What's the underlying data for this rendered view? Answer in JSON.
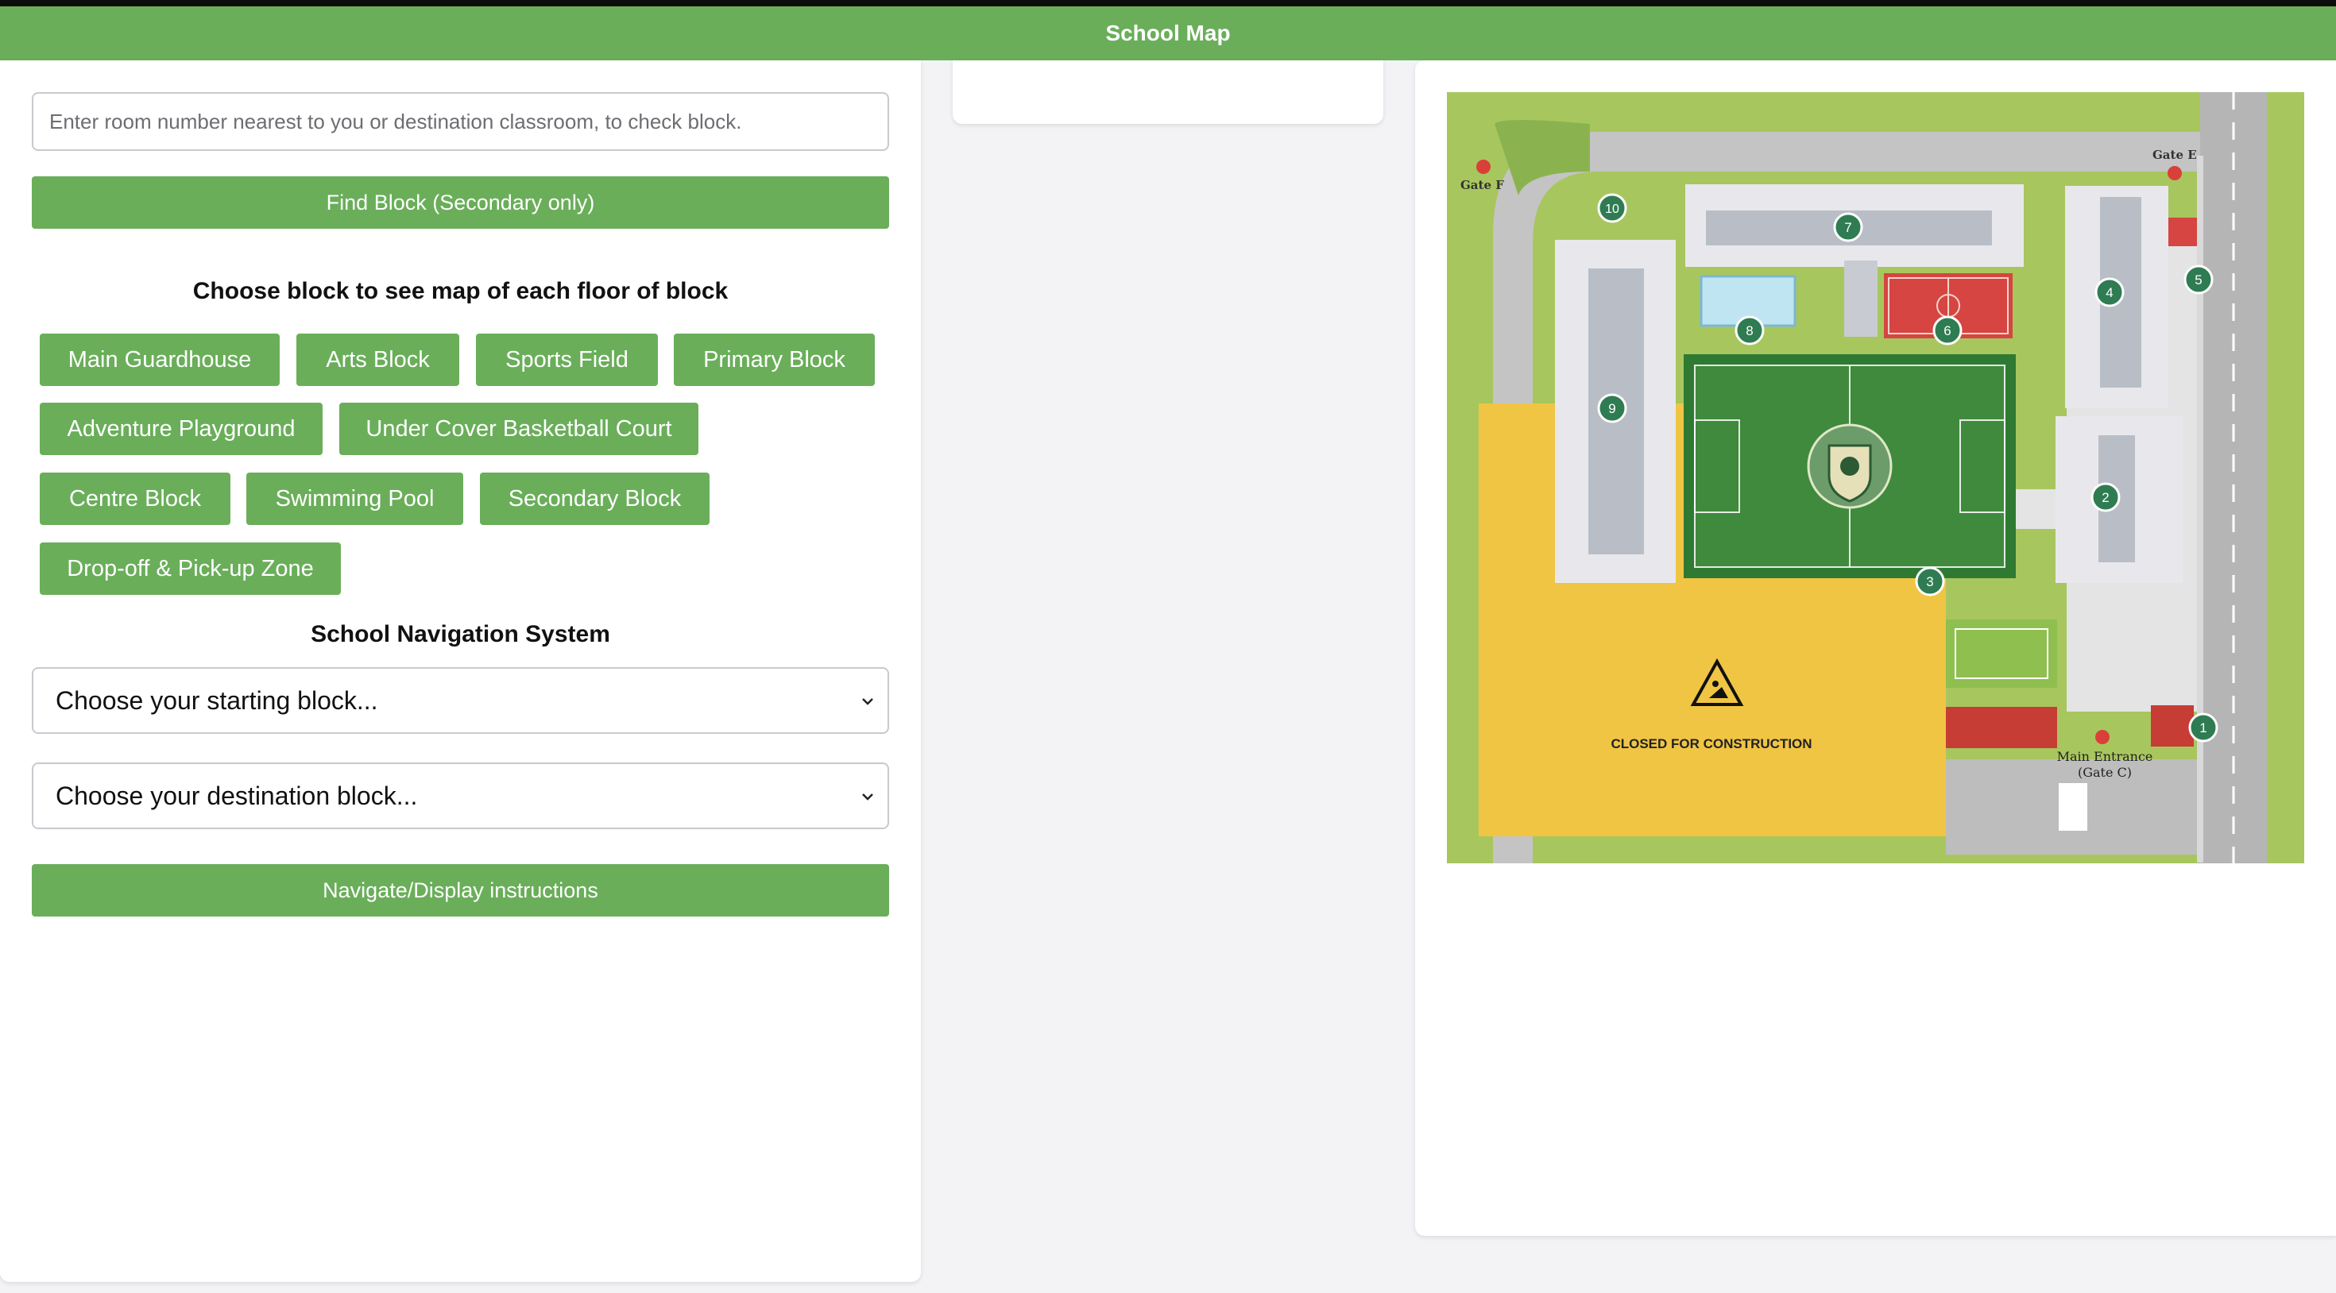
{
  "header": {
    "title": "School Map"
  },
  "search": {
    "placeholder": "Enter room number nearest to you or destination classroom, to check block."
  },
  "find_button": {
    "label": "Find Block (Secondary only)"
  },
  "blocks_section": {
    "title": "Choose block to see map of each floor of block",
    "buttons": [
      "Main Guardhouse",
      "Arts Block",
      "Sports Field",
      "Primary Block",
      "Adventure Playground",
      "Under Cover Basketball Court",
      "Centre Block",
      "Swimming Pool",
      "Secondary Block",
      "Drop-off & Pick-up Zone"
    ]
  },
  "navigation": {
    "title": "School Navigation System",
    "start_select": "Choose your starting block...",
    "dest_select": "Choose your destination block...",
    "button": "Navigate/Display instructions"
  },
  "map": {
    "labels": {
      "gate_e": "Gate E",
      "gate_f": "Gate F",
      "main_entrance": "Main Entrance",
      "gate_c": "(Gate C)",
      "construction": "CLOSED FOR CONSTRUCTION"
    },
    "markers": [
      "1",
      "2",
      "3",
      "4",
      "5",
      "6",
      "7",
      "8",
      "9",
      "10"
    ],
    "colors": {
      "grass": "#a8c65e",
      "road": "#bcbcbc",
      "field": "#3f8a3d",
      "construction": "#f0c544",
      "marker": "#2f7c52",
      "court": "#d64541"
    }
  }
}
